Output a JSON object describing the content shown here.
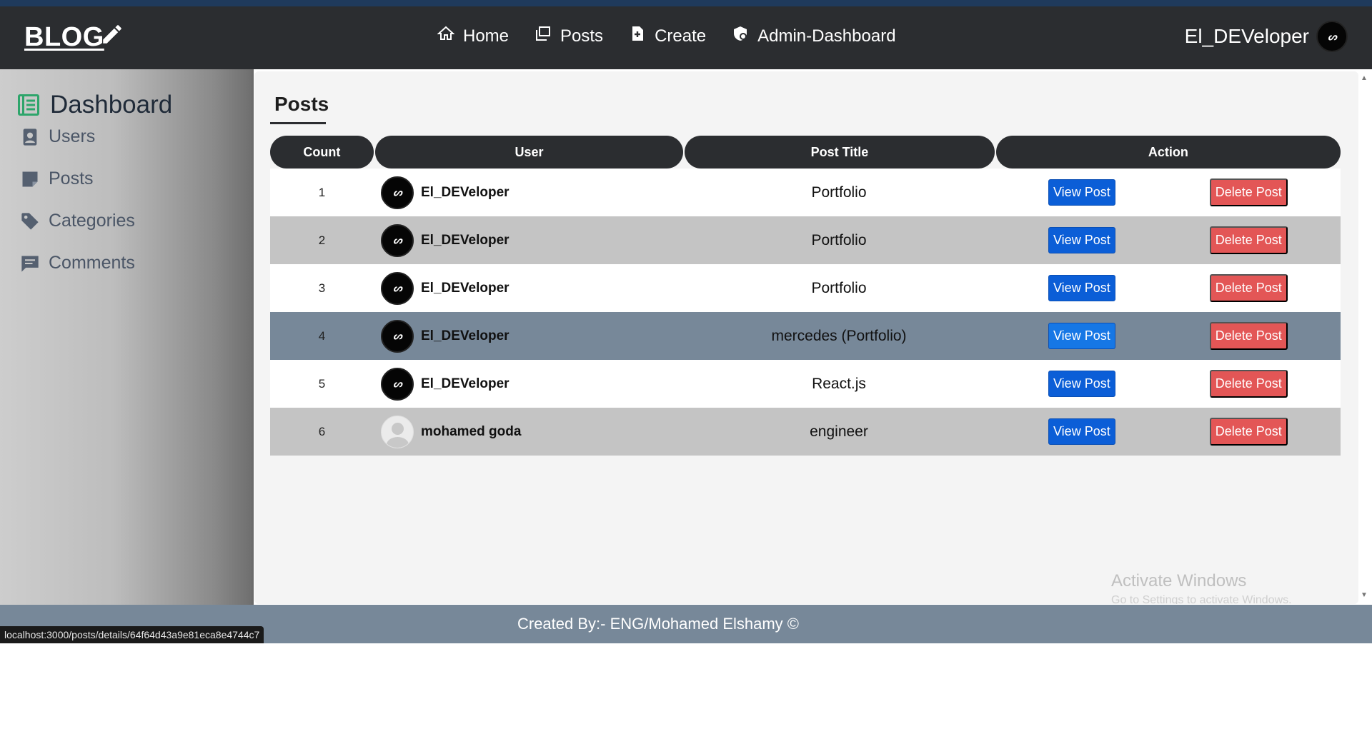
{
  "navbar": {
    "logo": "BLOG",
    "links": [
      {
        "label": "Home",
        "icon": "home-icon"
      },
      {
        "label": "Posts",
        "icon": "posts-icon"
      },
      {
        "label": "Create",
        "icon": "create-file-icon"
      },
      {
        "label": "Admin-Dashboard",
        "icon": "admin-shield-icon"
      }
    ],
    "username": "El_DEVeloper",
    "avatar_text": "ᔕ"
  },
  "sidebar": {
    "title": "Dashboard",
    "items": [
      {
        "label": "Users",
        "icon": "user-badge-icon"
      },
      {
        "label": "Posts",
        "icon": "note-icon"
      },
      {
        "label": "Categories",
        "icon": "tag-icon"
      },
      {
        "label": "Comments",
        "icon": "comment-icon"
      }
    ]
  },
  "main": {
    "title": "Posts",
    "table": {
      "headers": [
        "Count",
        "User",
        "Post Title",
        "Action"
      ],
      "rows": [
        {
          "count": "1",
          "user": "El_DEVeloper",
          "avatar": "dark",
          "title": "Portfolio",
          "view": "View Post",
          "delete": "Delete Post"
        },
        {
          "count": "2",
          "user": "El_DEVeloper",
          "avatar": "dark",
          "title": "Portfolio",
          "view": "View Post",
          "delete": "Delete Post"
        },
        {
          "count": "3",
          "user": "El_DEVeloper",
          "avatar": "dark",
          "title": "Portfolio",
          "view": "View Post",
          "delete": "Delete Post"
        },
        {
          "count": "4",
          "user": "El_DEVeloper",
          "avatar": "dark",
          "title": "mercedes (Portfolio)",
          "view": "View Post",
          "delete": "Delete Post"
        },
        {
          "count": "5",
          "user": "El_DEVeloper",
          "avatar": "dark",
          "title": "React.js",
          "view": "View Post",
          "delete": "Delete Post"
        },
        {
          "count": "6",
          "user": "mohamed goda",
          "avatar": "default",
          "title": "engineer",
          "view": "View Post",
          "delete": "Delete Post"
        }
      ]
    }
  },
  "watermark": {
    "line1": "Activate Windows",
    "line2": "Go to Settings to activate Windows."
  },
  "footer": {
    "text": "Created By:- ENG/Mohamed Elshamy ©"
  },
  "statusbar": {
    "url": "localhost:3000/posts/details/64f64d43a9e81eca8e4744c7"
  },
  "colors": {
    "navbar_bg": "#2b2d30",
    "row_gray": "#c4c4c4",
    "row_hover": "#778899",
    "view_button": "#0b5ed7",
    "delete_button": "#e35656",
    "footer_bg": "#778899"
  }
}
